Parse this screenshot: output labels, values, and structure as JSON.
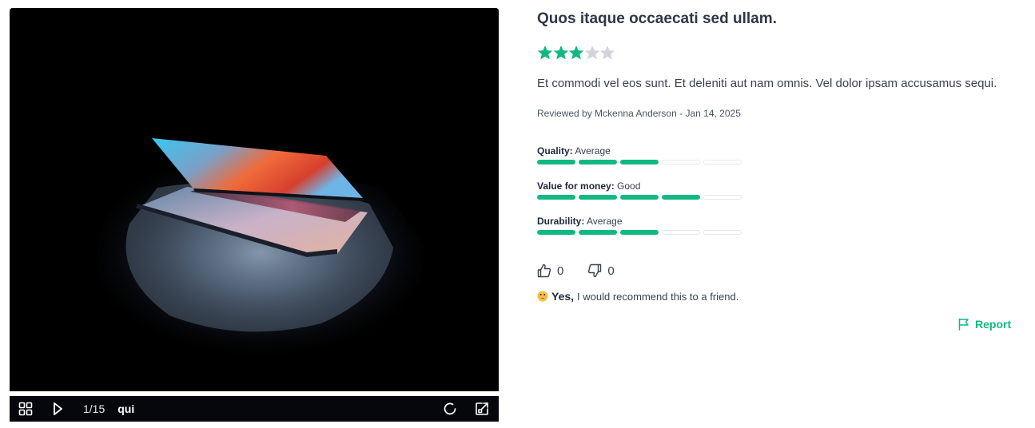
{
  "viewer": {
    "image_alt": "open laptop glowing in the dark",
    "counter": "1/15",
    "caption": "qui",
    "icons": [
      "grid-icon",
      "play-icon",
      "zoom-icon",
      "expand-icon"
    ]
  },
  "review": {
    "title": "Quos itaque occaecati sed ullam.",
    "rating": 3,
    "rating_max": 5,
    "body": "Et commodi vel eos sunt. Et deleniti aut nam omnis. Vel dolor ipsam accusamus sequi.",
    "reviewed_by_prefix": "Reviewed by",
    "reviewer": "Mckenna Anderson",
    "separator": "-",
    "date": "Jan 14, 2025",
    "metrics": [
      {
        "label": "Quality:",
        "value": "Average",
        "level": 3,
        "max": 5
      },
      {
        "label": "Value for money:",
        "value": "Good",
        "level": 4,
        "max": 5
      },
      {
        "label": "Durability:",
        "value": "Average",
        "level": 3,
        "max": 5
      }
    ],
    "helpful_count": "0",
    "unhelpful_count": "0",
    "recommend_yes": "Yes,",
    "recommend_text": "I would recommend this to a friend.",
    "report_label": "Report"
  },
  "colors": {
    "accent": "#10b981",
    "star_off": "#d1d5db",
    "text": "#374151",
    "viewer_bar": "#05070c"
  }
}
